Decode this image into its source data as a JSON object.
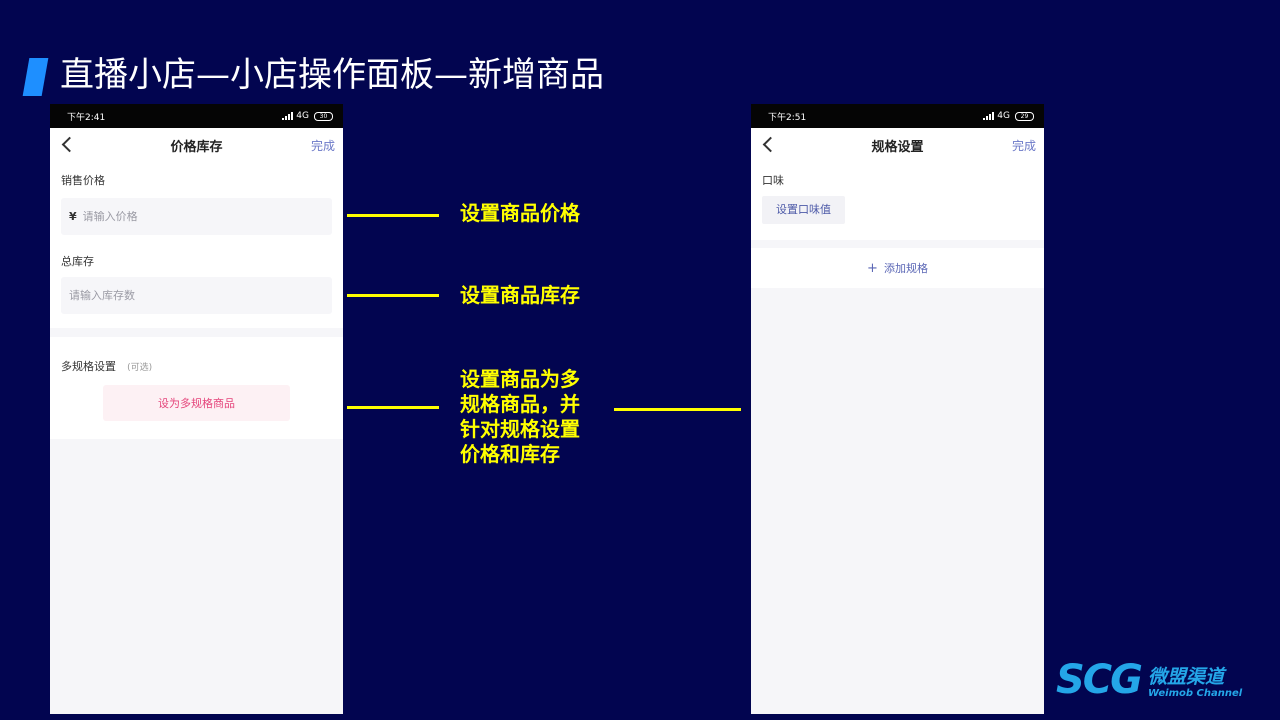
{
  "slide": {
    "title": "直播小店—小店操作面板—新增商品"
  },
  "phone_left": {
    "time": "下午2:41",
    "network": "4G",
    "battery": "30",
    "nav_title": "价格库存",
    "nav_done": "完成",
    "price_label": "销售价格",
    "price_prefix": "¥",
    "price_placeholder": "请输入价格",
    "stock_label": "总库存",
    "stock_placeholder": "请输入库存数",
    "multi_label": "多规格设置",
    "multi_optional": "(可选)",
    "multi_button": "设为多规格商品"
  },
  "phone_right": {
    "time": "下午2:51",
    "network": "4G",
    "battery": "29",
    "nav_title": "规格设置",
    "nav_done": "完成",
    "flavor_label": "口味",
    "flavor_button": "设置口味值",
    "add_spec": "添加规格"
  },
  "annotations": {
    "price": "设置商品价格",
    "stock": "设置商品库存",
    "multi": [
      "设置商品为多",
      "规格商品，并",
      "针对规格设置",
      "价格和库存"
    ]
  },
  "logo": {
    "mark": "SCG",
    "cn": "微盟渠道",
    "en": "Weimob Channel"
  },
  "colors": {
    "background": "#020550",
    "accent_blue": "#1e8fff",
    "annotation_yellow": "#ffff00",
    "pink_button_text": "#e5457b",
    "link_blue": "#6b78c7"
  }
}
